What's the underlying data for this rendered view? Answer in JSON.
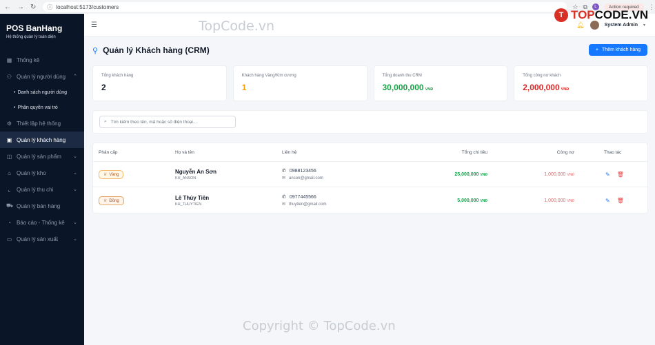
{
  "browser": {
    "url": "localhost:5173/customers",
    "action_label": "Action required",
    "profile_letter": "L"
  },
  "sidebar": {
    "brand_title": "POS BanHang",
    "brand_subtitle": "Hệ thống quản lý toàn diện",
    "items": [
      {
        "label": "Thống kê",
        "icon": "grid-icon"
      },
      {
        "label": "Quản lý người dùng",
        "icon": "users-icon",
        "expanded": true
      },
      {
        "label": "Thiết lập hệ thống",
        "icon": "gear-icon"
      },
      {
        "label": "Quản lý khách hàng",
        "icon": "contact-icon",
        "active": true
      },
      {
        "label": "Quản lý sản phẩm",
        "icon": "box-icon"
      },
      {
        "label": "Quản lý kho",
        "icon": "warehouse-icon"
      },
      {
        "label": "Quản lý thu chi",
        "icon": "chart-icon"
      },
      {
        "label": "Quản lý bán hàng",
        "icon": "cart-icon"
      },
      {
        "label": "Báo cáo - Thống kê",
        "icon": "report-icon"
      },
      {
        "label": "Quản lý sản xuất",
        "icon": "folder-icon"
      }
    ],
    "subitems": [
      {
        "label": "Danh sách người dùng"
      },
      {
        "label": "Phân quyền vai trò"
      }
    ]
  },
  "header": {
    "user_name": "System Admin"
  },
  "page": {
    "title": "Quản lý Khách hàng (CRM)",
    "add_button": "Thêm khách hàng"
  },
  "stats": [
    {
      "label": "Tổng khách hàng",
      "value": "2",
      "unit": "",
      "color": "#111827"
    },
    {
      "label": "Khách hàng Vàng/Kim cương",
      "value": "1",
      "unit": "",
      "color": "#f59e0b"
    },
    {
      "label": "Tổng doanh thu CRM",
      "value": "30,000,000",
      "unit": "VNĐ",
      "color": "#16a34a"
    },
    {
      "label": "Tổng công nợ khách",
      "value": "2,000,000",
      "unit": "VNĐ",
      "color": "#dc2626"
    }
  ],
  "search": {
    "placeholder": "Tìm kiếm theo tên, mã hoặc số điện thoại..."
  },
  "table": {
    "headers": [
      "Phân cấp",
      "Họ và tên",
      "Liên hệ",
      "Tổng chi tiêu",
      "Công nợ",
      "Thao tác"
    ],
    "rows": [
      {
        "tier": "Vàng",
        "name": "Nguyễn An Sơn",
        "code": "KH_ANSON",
        "phone": "0988123456",
        "email": "anson@gmail.com",
        "spend": "25,000,000",
        "spend_unit": "VNĐ",
        "debt": "1,000,000",
        "debt_unit": "VNĐ"
      },
      {
        "tier": "Đồng",
        "name": "Lê Thủy Tiên",
        "code": "KH_THUYTIEN",
        "phone": "0977445566",
        "email": "thuytien@gmail.com",
        "spend": "5,000,000",
        "spend_unit": "VNĐ",
        "debt": "1,000,000",
        "debt_unit": "VNĐ"
      }
    ]
  },
  "watermark": {
    "top": "TopCode.vn",
    "bottom": "Copyright © TopCode.vn",
    "logo_a": "TOP",
    "logo_b": "CODE.VN",
    "logo_mark": "T"
  }
}
